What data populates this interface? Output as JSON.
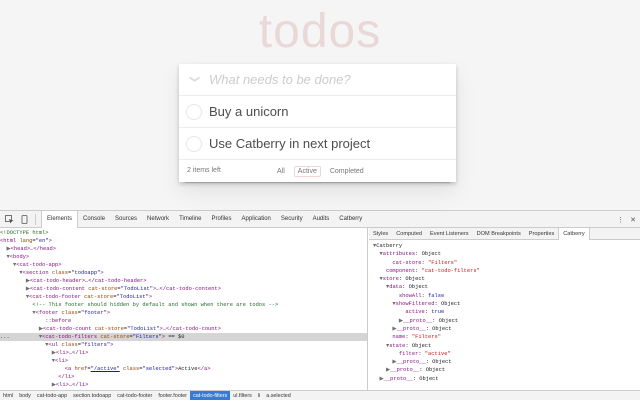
{
  "app": {
    "title": "todos",
    "new_todo_placeholder": "What needs to be done?",
    "items": [
      {
        "label": "Buy a unicorn"
      },
      {
        "label": "Use Catberry in next project"
      }
    ],
    "footer": {
      "items_left": "2 items left",
      "filters": [
        {
          "label": "All",
          "selected": false
        },
        {
          "label": "Active",
          "selected": true
        },
        {
          "label": "Completed",
          "selected": false
        }
      ]
    }
  },
  "devtools": {
    "tabs": [
      "Elements",
      "Console",
      "Sources",
      "Network",
      "Timeline",
      "Profiles",
      "Application",
      "Security",
      "Audits",
      "Catberry"
    ],
    "active_tab": "Elements",
    "side_tabs": [
      "Styles",
      "Computed",
      "Event Listeners",
      "DOM Breakpoints",
      "Properties",
      "Catberry"
    ],
    "active_side_tab": "Catberry",
    "breadcrumbs": [
      "html",
      "body",
      "cat-todo-app",
      "section.todoapp",
      "cat-todo-footer",
      "footer.footer",
      "cat-todo-filters",
      "ul.filters",
      "li",
      "a.selected"
    ],
    "active_breadcrumb": "cat-todo-filters",
    "colors": {
      "accent": "#3879d9",
      "tag": "#881280",
      "attr": "#994500",
      "value": "#1a1aa6",
      "comment": "#236e25"
    }
  }
}
